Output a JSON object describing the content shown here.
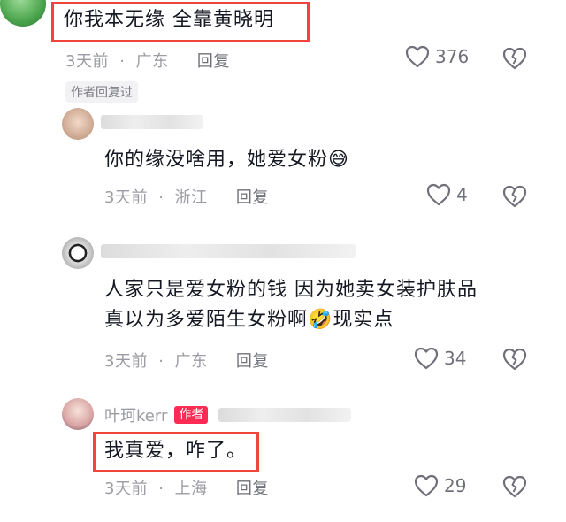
{
  "comment1": {
    "text": "你我本无缘 全靠黄晓明",
    "time": "3天前",
    "location": "广东",
    "reply_label": "回复",
    "likes": "376",
    "author_replied_chip": "作者回复过"
  },
  "reply1": {
    "text": "你的缘没啥用，她爱女粉😅",
    "time": "3天前",
    "location": "浙江",
    "reply_label": "回复",
    "likes": "4"
  },
  "reply2": {
    "text_line1": "人家只是爱女粉的钱 因为她卖女装护肤品",
    "text_line2": "真以为多爱陌生女粉啊🤣现实点",
    "time": "3天前",
    "location": "广东",
    "reply_label": "回复",
    "likes": "34"
  },
  "reply3": {
    "username": "叶珂kerr",
    "author_tag": "作者",
    "text": "我真爱，咋了。",
    "time": "3天前",
    "location": "上海",
    "reply_label": "回复",
    "likes": "29"
  },
  "colors": {
    "highlight_box": "#f0453a",
    "author_tag": "#fe2c55",
    "meta_text": "#9b9ca3"
  },
  "icons": {
    "like": "heart-outline-icon",
    "dislike": "broken-heart-icon"
  }
}
